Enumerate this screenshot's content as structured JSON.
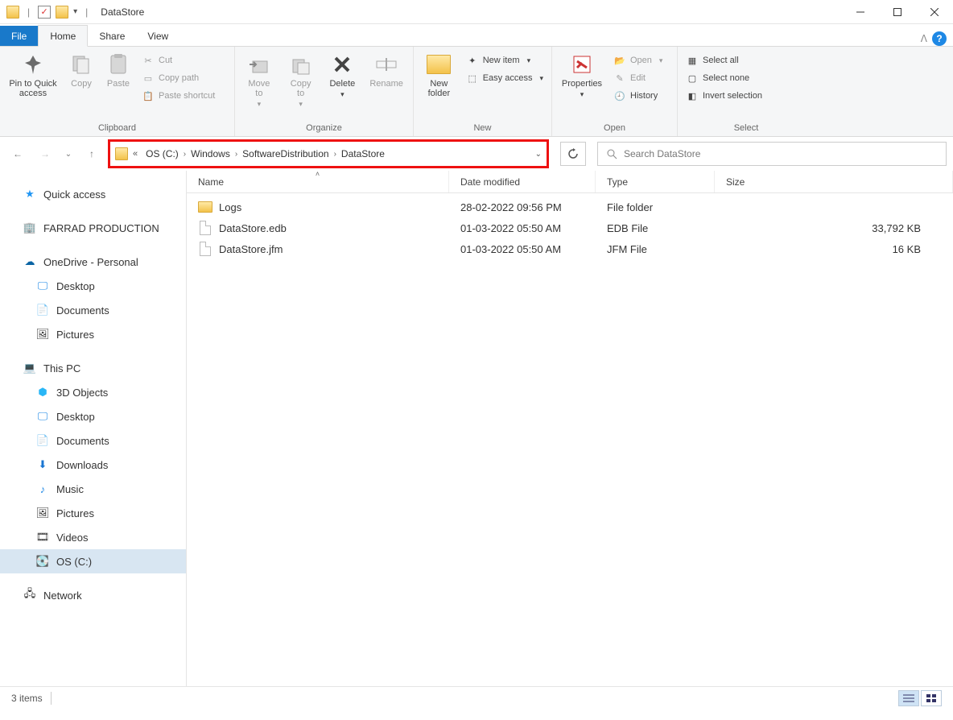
{
  "title": "DataStore",
  "tabs": {
    "file": "File",
    "home": "Home",
    "share": "Share",
    "view": "View"
  },
  "ribbon": {
    "clipboard": {
      "label": "Clipboard",
      "pin": "Pin to Quick\naccess",
      "copy": "Copy",
      "paste": "Paste",
      "cut": "Cut",
      "copy_path": "Copy path",
      "paste_shortcut": "Paste shortcut"
    },
    "organize": {
      "label": "Organize",
      "move_to": "Move\nto",
      "copy_to": "Copy\nto",
      "delete": "Delete",
      "rename": "Rename"
    },
    "new": {
      "label": "New",
      "new_folder": "New\nfolder",
      "new_item": "New item",
      "easy_access": "Easy access"
    },
    "open": {
      "label": "Open",
      "properties": "Properties",
      "open": "Open",
      "edit": "Edit",
      "history": "History"
    },
    "select": {
      "label": "Select",
      "select_all": "Select all",
      "select_none": "Select none",
      "invert": "Invert selection"
    }
  },
  "breadcrumb": [
    "OS (C:)",
    "Windows",
    "SoftwareDistribution",
    "DataStore"
  ],
  "search_placeholder": "Search DataStore",
  "sidebar": {
    "quick_access": "Quick access",
    "farrad": "FARRAD PRODUCTION",
    "onedrive": "OneDrive - Personal",
    "od_desktop": "Desktop",
    "od_documents": "Documents",
    "od_pictures": "Pictures",
    "this_pc": "This PC",
    "pc_3d": "3D Objects",
    "pc_desktop": "Desktop",
    "pc_documents": "Documents",
    "pc_downloads": "Downloads",
    "pc_music": "Music",
    "pc_pictures": "Pictures",
    "pc_videos": "Videos",
    "pc_os": "OS (C:)",
    "network": "Network"
  },
  "columns": {
    "name": "Name",
    "date": "Date modified",
    "type": "Type",
    "size": "Size"
  },
  "files": [
    {
      "name": "Logs",
      "date": "28-02-2022 09:56 PM",
      "type": "File folder",
      "size": "",
      "kind": "folder"
    },
    {
      "name": "DataStore.edb",
      "date": "01-03-2022 05:50 AM",
      "type": "EDB File",
      "size": "33,792 KB",
      "kind": "file"
    },
    {
      "name": "DataStore.jfm",
      "date": "01-03-2022 05:50 AM",
      "type": "JFM File",
      "size": "16 KB",
      "kind": "file"
    }
  ],
  "status": "3 items"
}
